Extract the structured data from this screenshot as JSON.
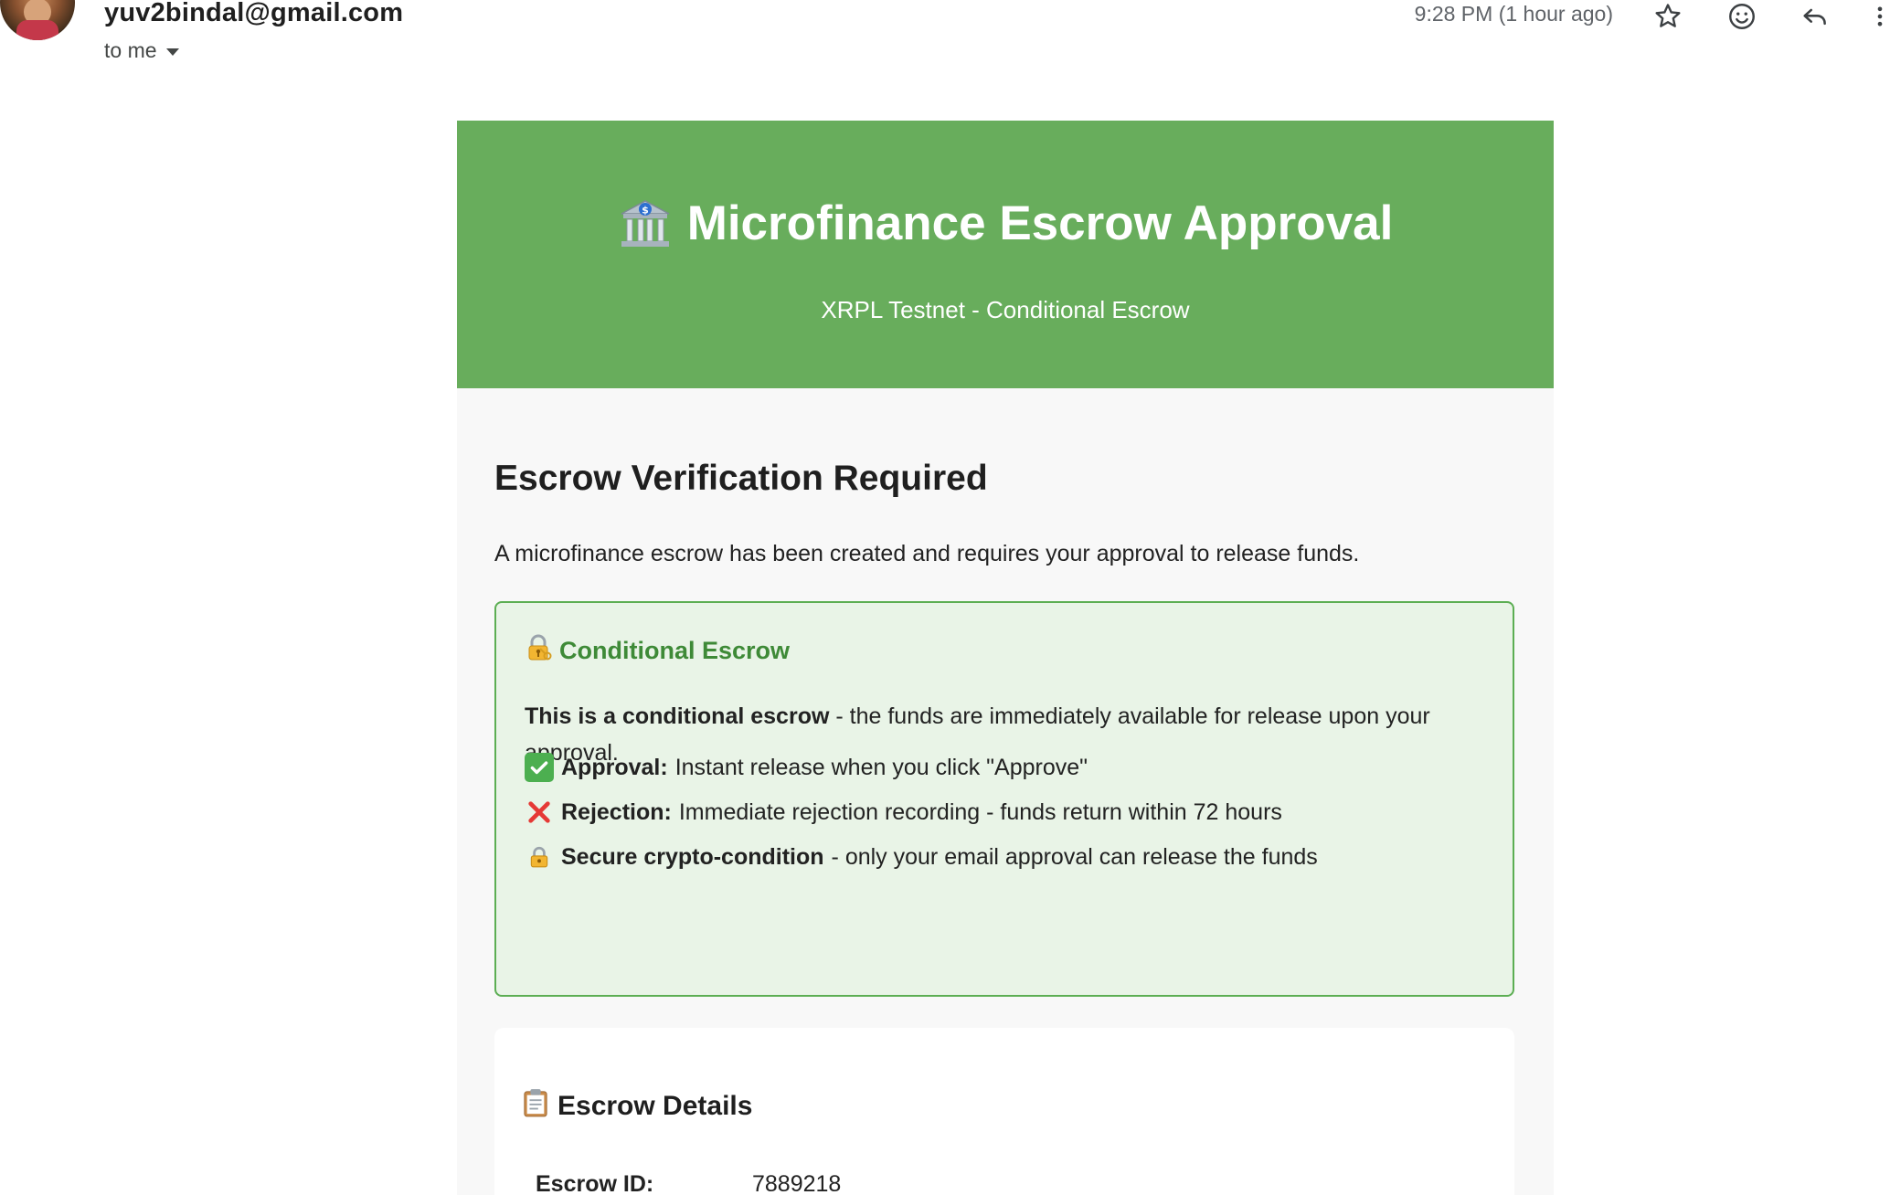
{
  "header": {
    "sender": "yuv2bindal@gmail.com",
    "recipient_label": "to me",
    "timestamp": "9:28 PM (1 hour ago)",
    "icons": [
      "star-icon",
      "emoji-icon",
      "reply-icon",
      "more-vert-icon"
    ]
  },
  "banner": {
    "icon": "bank-icon",
    "title": "Microfinance Escrow Approval",
    "subtitle": "XRPL Testnet - Conditional Escrow",
    "color": "#68ad5c"
  },
  "main": {
    "heading": "Escrow Verification Required",
    "intro": "A microfinance escrow has been created and requires your approval to release funds."
  },
  "conditional": {
    "icon": "locked-with-key-icon",
    "title": "Conditional Escrow",
    "desc_bold": "This is a conditional escrow",
    "desc_rest": " - the funds are immediately available for release upon your approval.",
    "items": [
      {
        "icon": "check-mark-icon",
        "bold": "Approval:",
        "text": " Instant release when you click \"Approve\""
      },
      {
        "icon": "cross-mark-icon",
        "bold": "Rejection:",
        "text": " Immediate rejection recording - funds return within 72 hours"
      },
      {
        "icon": "lock-icon",
        "bold": "Secure crypto-condition",
        "text": " - only your email approval can release the funds"
      }
    ],
    "border_color": "#5cae53",
    "background_color": "#e9f4e7",
    "title_color": "#3e8a37"
  },
  "details": {
    "icon": "clipboard-icon",
    "title": "Escrow Details",
    "rows": [
      {
        "label": "Escrow ID:",
        "value": "7889218"
      }
    ]
  }
}
